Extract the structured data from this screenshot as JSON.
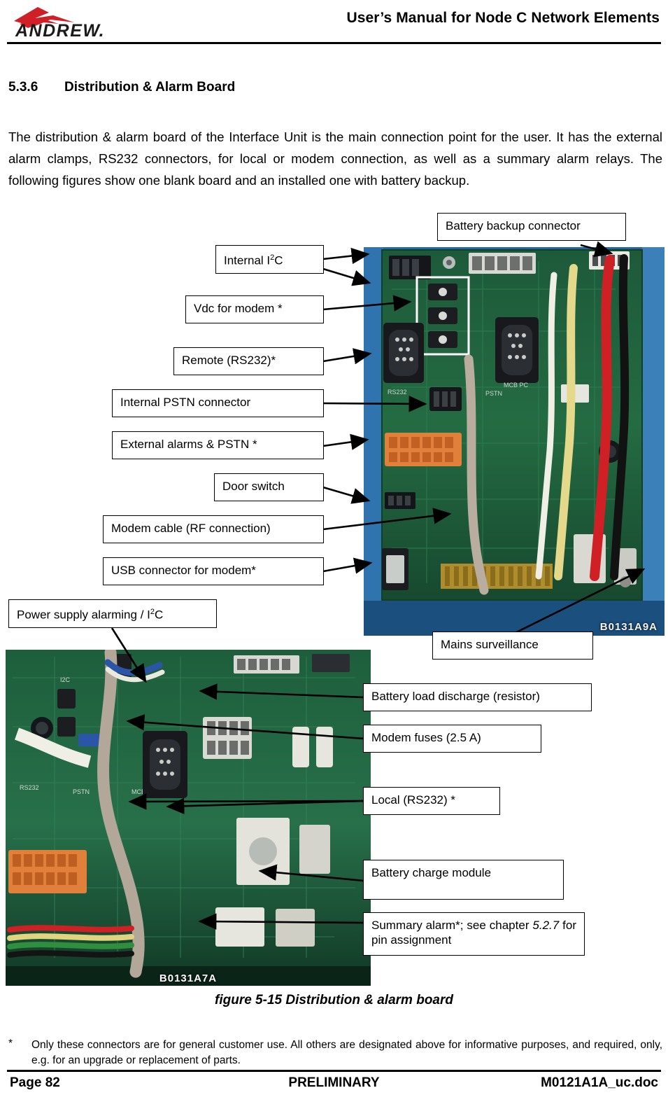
{
  "header": {
    "title": "User’s Manual for Node C Network Elements",
    "logo_text": "ANDREW."
  },
  "section": {
    "number": "5.3.6",
    "title": "Distribution & Alarm Board",
    "paragraph": "The distribution & alarm board of the Interface Unit is the main connection point for the user. It has the external alarm clamps, RS232 connectors, for local or modem connection, as well as a summary alarm relays. The following figures show one blank board and an installed one with battery backup."
  },
  "figure": {
    "caption": "figure 5-15 Distribution & alarm board",
    "photo_top_label": "B0131A9A",
    "photo_bottom_label": "B0131A7A",
    "callouts": {
      "battery_backup": "Battery backup connector",
      "internal_i2c_pre": "Internal I",
      "internal_i2c_sup": "2",
      "internal_i2c_post": "C",
      "vdc_modem": "Vdc for modem *",
      "remote_rs232": "Remote (RS232)*",
      "internal_pstn": "Internal PSTN connector",
      "external_alarms": "External alarms & PSTN *",
      "door_switch": "Door switch",
      "modem_cable": "Modem cable (RF connection)",
      "usb_connector": "USB connector for modem*",
      "power_supply_pre": "Power supply alarming / I",
      "power_supply_sup": "2",
      "power_supply_post": "C",
      "mains_surveillance": "Mains surveillance",
      "battery_load": "Battery load discharge (resistor)",
      "modem_fuses": "Modem fuses (2.5 A)",
      "local_rs232": "Local (RS232) *",
      "battery_charge": "Battery charge module",
      "summary_alarm_a": "Summary alarm*; see chapter ",
      "summary_alarm_italic": "5.2.7",
      "summary_alarm_b": " for pin assignment"
    }
  },
  "footnote": {
    "marker": "*",
    "text": "Only these connectors are for general customer use. All others are designated above for informative purposes, and required, only, e.g. for an upgrade or replacement of parts."
  },
  "footer": {
    "left": "Page 82",
    "center": "PRELIMINARY",
    "right": "M0121A1A_uc.doc"
  }
}
